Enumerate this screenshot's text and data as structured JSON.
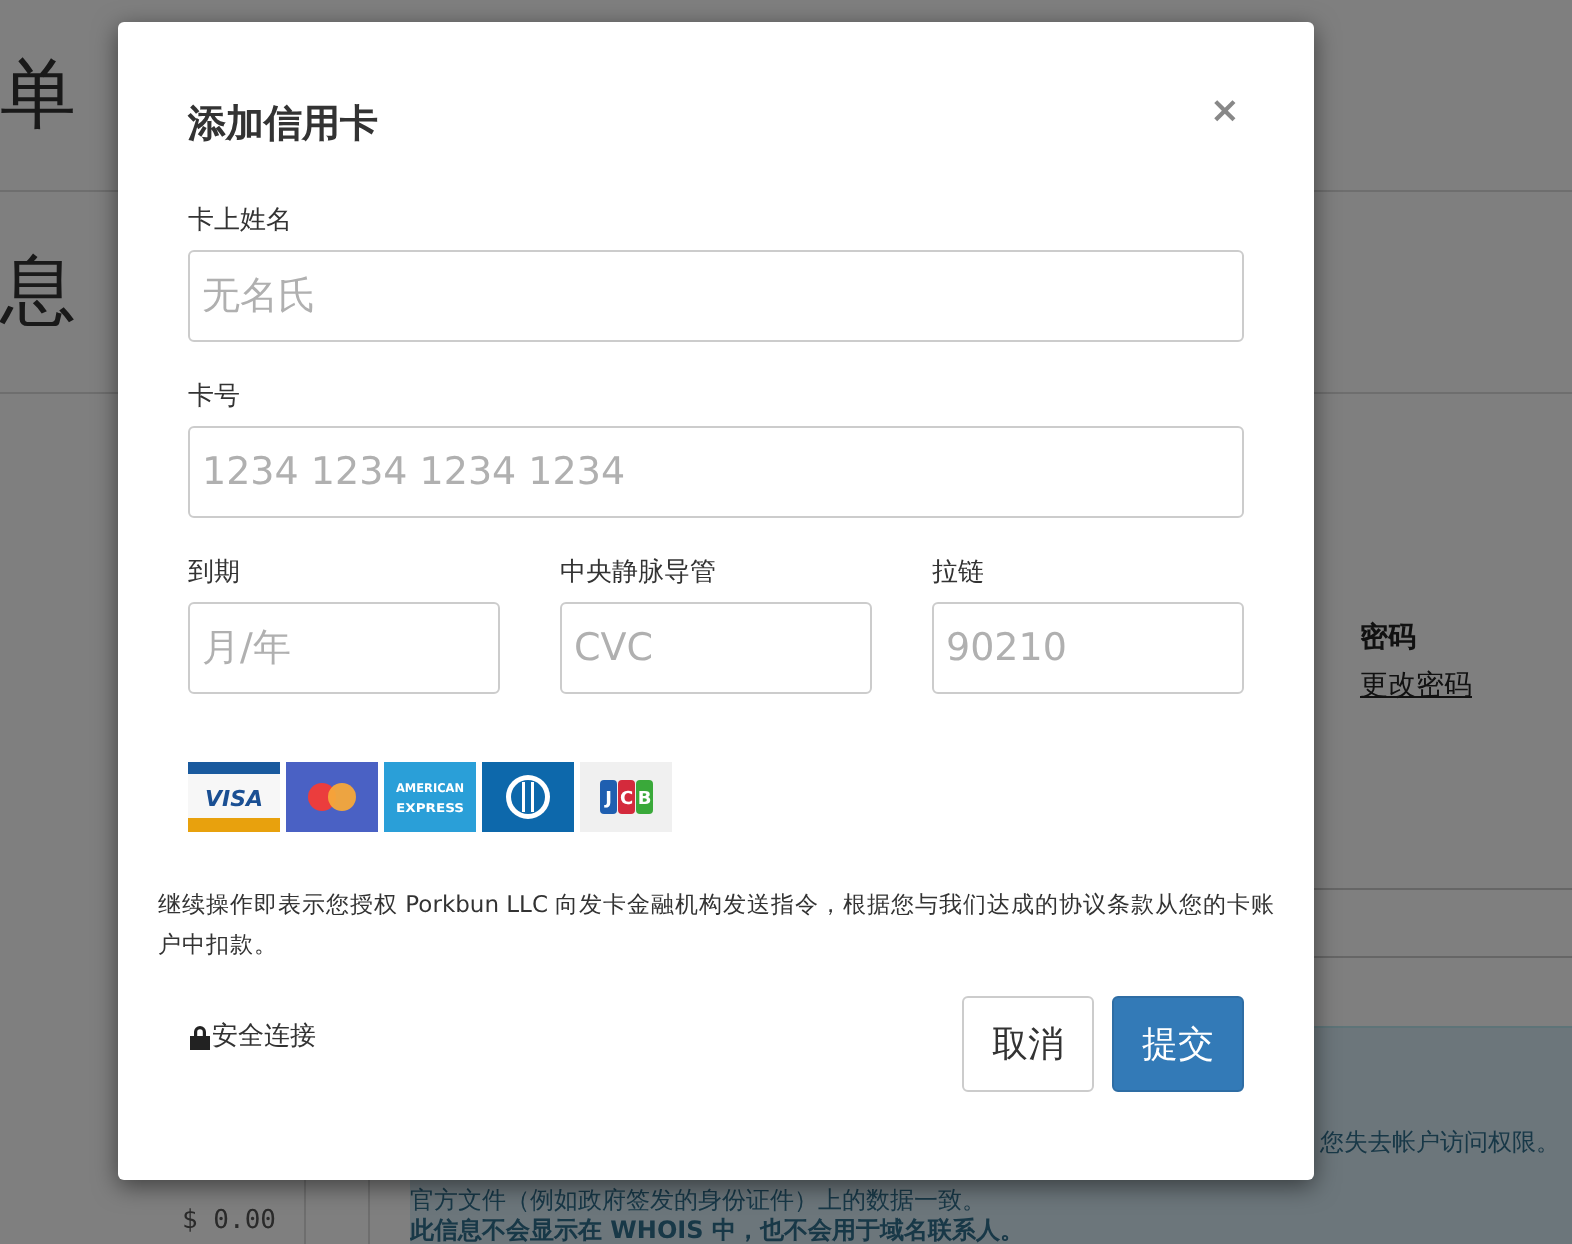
{
  "background": {
    "page_title": "单",
    "section_title": "息",
    "password": {
      "label": "密码",
      "link": "更改密码"
    },
    "balance": "$ 0.00",
    "notice": {
      "line_1": "您失去帐户访问权限。",
      "line_2": "官方文件（例如政府签发的身份证件）上的数据一致。",
      "line_3": "此信息不会显示在 WHOIS 中，也不会用于域名联系人。"
    }
  },
  "dialog": {
    "title": "添加信用卡",
    "close": "×",
    "fields": [
      {
        "label": "卡上姓名",
        "placeholder": "无名氏"
      },
      {
        "label": "卡号",
        "placeholder": "1234 1234 1234 1234"
      }
    ],
    "row_fields": [
      {
        "label": "到期",
        "placeholder": "月/年"
      },
      {
        "label": "中央静脉导管",
        "placeholder": "CVC"
      },
      {
        "label": "拉链",
        "placeholder": "90210"
      }
    ],
    "cards": [
      {
        "kind": "visa",
        "text": "VISA"
      },
      {
        "kind": "mastercard"
      },
      {
        "kind": "amex",
        "lines": [
          "AMERICAN",
          "EXPRESS"
        ]
      },
      {
        "kind": "diners"
      },
      {
        "kind": "jcb",
        "letters": [
          "J",
          "C",
          "B"
        ]
      }
    ],
    "authorization": "继续操作即表示您授权 Porkbun LLC 向发卡金融机构发送指令，根据您与我们达成的协议条款从您的卡账户中扣款。",
    "secure": "安全连接",
    "buttons": [
      {
        "kind": "secondary",
        "label": "取消"
      },
      {
        "kind": "primary",
        "label": "提交"
      }
    ]
  }
}
